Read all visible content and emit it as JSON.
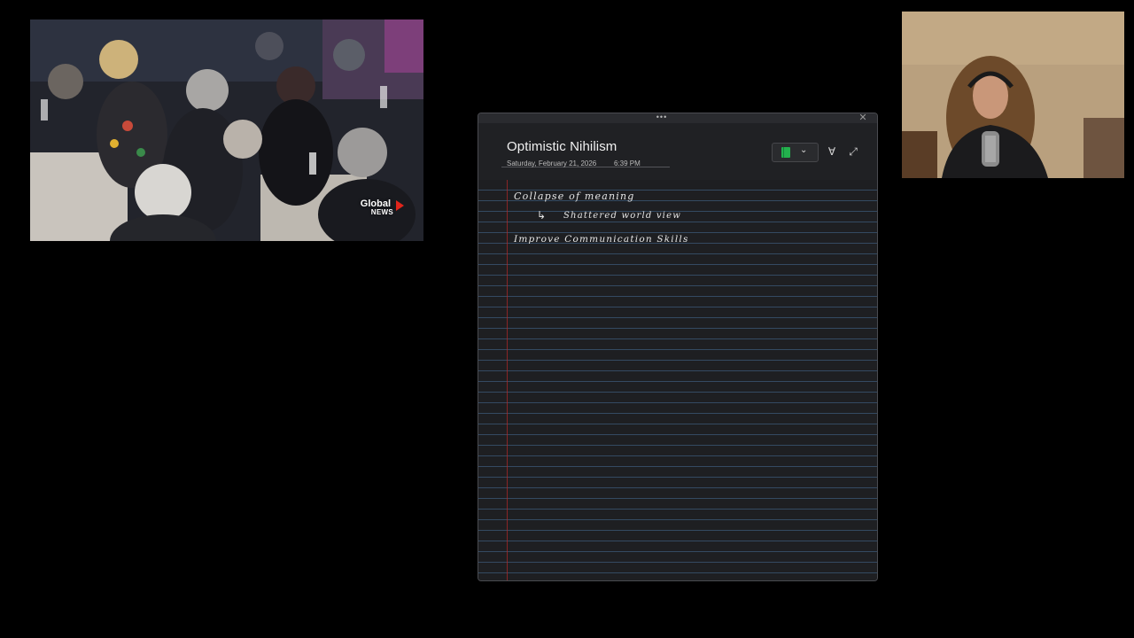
{
  "video": {
    "logo_line1": "Global",
    "logo_line2": "NEWS"
  },
  "note": {
    "title": "Optimistic Nihilism",
    "date": "Saturday, February 21, 2026",
    "time": "6:39 PM",
    "grip_glyph": "•••",
    "close_glyph": "✕",
    "section_color": "#23b14d",
    "pen_glyph": "∀",
    "expand_glyph": "⤢",
    "chevron_glyph": "⌄",
    "ink": {
      "line1": "Collapse of meaning",
      "arrow": "↳",
      "line2": "Shattered world view",
      "line3": "Improve Communication Skills"
    }
  }
}
